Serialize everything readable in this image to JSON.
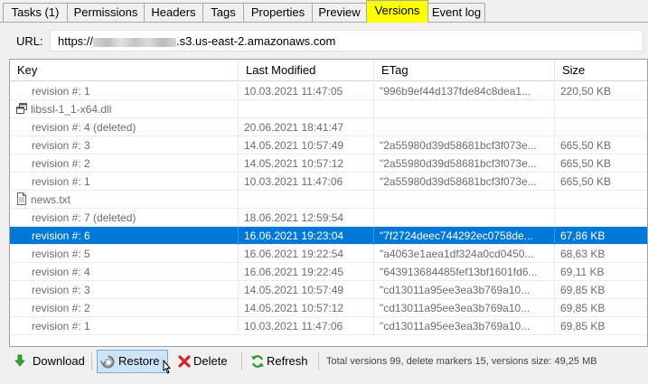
{
  "tabs": [
    {
      "label": "Tasks (1)",
      "active": false
    },
    {
      "label": "Permissions",
      "active": false
    },
    {
      "label": "Headers",
      "active": false
    },
    {
      "label": "Tags",
      "active": false
    },
    {
      "label": "Properties",
      "active": false
    },
    {
      "label": "Preview",
      "active": false
    },
    {
      "label": "Versions",
      "active": true
    },
    {
      "label": "Event log",
      "active": false
    }
  ],
  "url": {
    "label": "URL:",
    "prefix": "https://",
    "suffix": ".s3.us-east-2.amazonaws.com"
  },
  "grid": {
    "columns": [
      "Key",
      "Last Modified",
      "ETag",
      "Size"
    ],
    "rows": [
      {
        "type": "version",
        "key": "revision #: 1",
        "modified": "10.03.2021 11:47:05",
        "etag": "\"996b9ef44d137fde84c8dea1...",
        "size": "220,50 KB"
      },
      {
        "type": "file",
        "icon": "dll-file-icon",
        "key": "libssl-1_1-x64.dll",
        "modified": "",
        "etag": "",
        "size": ""
      },
      {
        "type": "version",
        "key": "revision #: 4 (deleted)",
        "modified": "20.06.2021 18:41:47",
        "etag": "",
        "size": ""
      },
      {
        "type": "version",
        "key": "revision #: 3",
        "modified": "14.05.2021 10:57:49",
        "etag": "\"2a55980d39d58681bcf3f073e...",
        "size": "665,50 KB"
      },
      {
        "type": "version",
        "key": "revision #: 2",
        "modified": "14.05.2021 10:57:12",
        "etag": "\"2a55980d39d58681bcf3f073e...",
        "size": "665,50 KB"
      },
      {
        "type": "version",
        "key": "revision #: 1",
        "modified": "10.03.2021 11:47:06",
        "etag": "\"2a55980d39d58681bcf3f073e...",
        "size": "665,50 KB"
      },
      {
        "type": "file",
        "icon": "text-file-icon",
        "key": "news.txt",
        "modified": "",
        "etag": "",
        "size": ""
      },
      {
        "type": "version",
        "key": "revision #: 7 (deleted)",
        "modified": "18.06.2021 12:59:54",
        "etag": "",
        "size": ""
      },
      {
        "type": "version",
        "selected": true,
        "key": "revision #: 6",
        "modified": "16.06.2021 19:23:04",
        "etag": "\"7f2724deec744292ec0758de...",
        "size": "67,86 KB"
      },
      {
        "type": "version",
        "key": "revision #: 5",
        "modified": "16.06.2021 19:22:54",
        "etag": "\"a4063e1aea1df324a0cd0450...",
        "size": "68,63 KB"
      },
      {
        "type": "version",
        "key": "revision #: 4",
        "modified": "16.06.2021 19:22:45",
        "etag": "\"643913684485fef13bf1601fd6...",
        "size": "69,11 KB"
      },
      {
        "type": "version",
        "key": "revision #: 3",
        "modified": "14.05.2021 10:57:49",
        "etag": "\"cd13011a95ee3ea3b769a10...",
        "size": "69,85 KB"
      },
      {
        "type": "version",
        "key": "revision #: 2",
        "modified": "14.05.2021 10:57:12",
        "etag": "\"cd13011a95ee3ea3b769a10...",
        "size": "69,85 KB"
      },
      {
        "type": "version",
        "key": "revision #: 1",
        "modified": "10.03.2021 11:47:06",
        "etag": "\"cd13011a95ee3ea3b769a10...",
        "size": "69,85 KB"
      }
    ]
  },
  "toolbar": {
    "download_label": "Download",
    "restore_label": "Restore",
    "delete_label": "Delete",
    "refresh_label": "Refresh",
    "status": "Total versions 99, delete markers 15, versions size: 49,25 MB"
  },
  "colors": {
    "active_tab": "#ffff00",
    "selection": "#0078d7",
    "hot_button": "#cce4f7"
  }
}
